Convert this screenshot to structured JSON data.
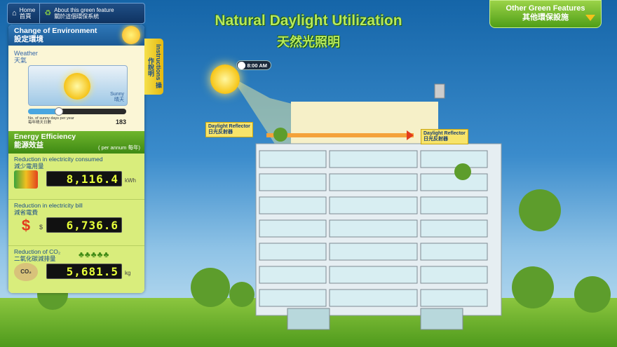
{
  "nav": {
    "home_label": "Home",
    "home_label_zh": "首頁",
    "about_label": "About this green feature",
    "about_label_zh": "關於這個環保系統",
    "other_label": "Other Green Features",
    "other_label_zh": "其他環保設施"
  },
  "header": {
    "title": "Natural Daylight Utilization",
    "title_zh": "天然光照明"
  },
  "panel": {
    "env_title": "Change of Environment",
    "env_title_zh": "設定環境",
    "weather_label": "Weather",
    "weather_label_zh": "天氣",
    "weather_state": "Sunny",
    "weather_state_zh": "晴天",
    "sunny_days_label": "No. of sunny days per year",
    "sunny_days_label_zh": "每年晴天日數",
    "sunny_days": "183",
    "energy_title": "Energy Efficiency",
    "energy_title_zh": "能源效益",
    "per_annum": "( per annum 每年)",
    "metrics": [
      {
        "label": "Reduction in electricity consumed",
        "label_zh": "減少電用量",
        "value": "8,116.4",
        "unit": "kWh"
      },
      {
        "label": "Reduction in electricity bill",
        "label_zh": "減省電費",
        "value": "6,736.6",
        "prefix": "$"
      },
      {
        "label": "Reduction of CO₂",
        "label_zh": "二氧化碳減排量",
        "value": "5,681.5",
        "unit": "kg"
      }
    ]
  },
  "instructions": {
    "label": "Instructions",
    "label_zh": "操作說明"
  },
  "scene": {
    "time": "8:00 AM",
    "reflector_left": "Daylight Reflector",
    "reflector_left_zh": "日光反射器",
    "reflector_right": "Daylight Reflector",
    "reflector_right_zh": "日光反射器"
  },
  "colors": {
    "accent_green": "#6fb52c",
    "nav_blue": "#1f4f86",
    "lcd_text": "#e8ff3a"
  }
}
